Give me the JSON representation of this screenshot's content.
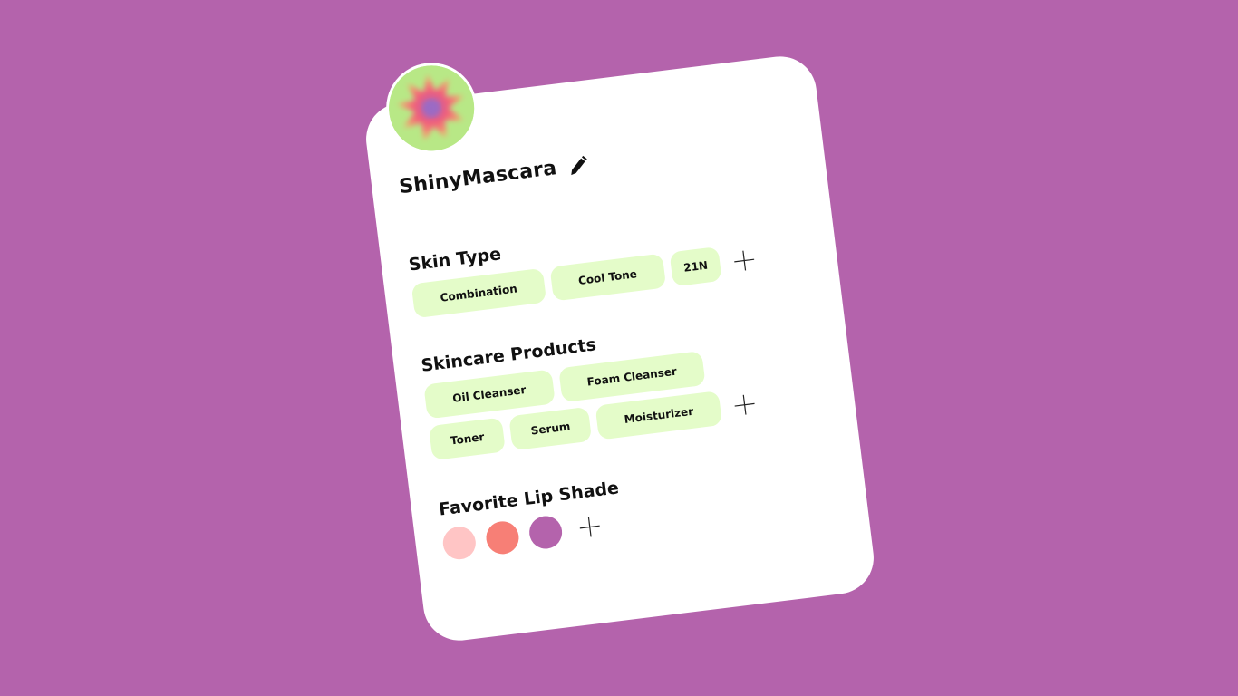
{
  "profile": {
    "username": "ShinyMascara",
    "edit_icon": "pencil-icon"
  },
  "skin_type": {
    "title": "Skin Type",
    "chips": [
      "Combination",
      "Cool Tone",
      "21N"
    ],
    "add_icon": "plus-icon"
  },
  "skincare": {
    "title": "Skincare Products",
    "chips_row1": [
      "Oil Cleanser",
      "Foam Cleanser"
    ],
    "chips_row2": [
      "Toner",
      "Serum",
      "Moisturizer"
    ],
    "add_icon": "plus-icon"
  },
  "lip_shade": {
    "title": "Favorite Lip Shade",
    "colors": [
      "#ffc5c5",
      "#f77f76",
      "#b463ac"
    ],
    "add_icon": "plus-icon"
  },
  "theme": {
    "background": "#b463ac",
    "card": "#ffffff",
    "chip": "#e4fcc9",
    "avatar_base": "#b8e886"
  }
}
